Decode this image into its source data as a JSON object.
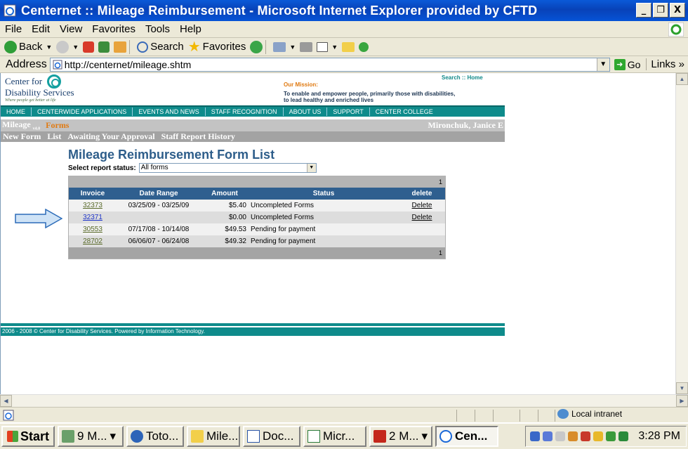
{
  "window": {
    "title": "Centernet :: Mileage Reimbursement - Microsoft Internet Explorer provided by CFTD",
    "minimize": "_",
    "maximize": "ř",
    "close": "X"
  },
  "menu": [
    "File",
    "Edit",
    "View",
    "Favorites",
    "Tools",
    "Help"
  ],
  "toolbar": {
    "back": "Back",
    "search": "Search",
    "favorites": "Favorites"
  },
  "address": {
    "label": "Address",
    "url": "http://centernet/mileage.shtm",
    "go": "Go",
    "links": "Links"
  },
  "site": {
    "logo_line1": "Center for",
    "logo_line2": "Disability Services",
    "logo_tagline": "Where people get better at life",
    "mission_label": "Our Mission:",
    "mission_text_1": "To enable and empower people, primarily those with disabilities,",
    "mission_text_2": "to lead healthy and enriched lives",
    "toplinks": "Search :: Home",
    "nav": [
      "HOME",
      "CENTERWIDE APPLICATIONS",
      "EVENTS AND NEWS",
      "STAFF RECOGNITION",
      "ABOUT US",
      "SUPPORT",
      "CENTER COLLEGE"
    ],
    "app_name": "Mileage",
    "app_version": "v4.0",
    "section": "Forms",
    "user": "Mironchuk, Janice E",
    "subnav": [
      "New Form",
      "List",
      "Awaiting Your Approval",
      "Staff Report History"
    ],
    "footer": "2006 - 2008 © Center for Disability Services. Powered by Information Technology."
  },
  "form": {
    "title": "Mileage Reimbursement Form List",
    "status_label": "Select report status:",
    "status_value": "All forms",
    "page_top": "1",
    "page_bottom": "1",
    "columns": [
      "Invoice",
      "Date Range",
      "Amount",
      "Status",
      "delete"
    ],
    "rows": [
      {
        "invoice": "32373",
        "range": "03/25/09 - 03/25/09",
        "amount": "$5.40",
        "status": "Uncompleted Forms",
        "delete": "Delete"
      },
      {
        "invoice": "32371",
        "range": "",
        "amount": "$0.00",
        "status": "Uncompleted Forms",
        "delete": "Delete"
      },
      {
        "invoice": "30553",
        "range": "07/17/08 - 10/14/08",
        "amount": "$49.53",
        "status": "Pending for payment",
        "delete": ""
      },
      {
        "invoice": "28702",
        "range": "06/06/07 - 06/24/08",
        "amount": "$49.32",
        "status": "Pending for payment",
        "delete": ""
      }
    ]
  },
  "statusbar": {
    "zone": "Local intranet"
  },
  "taskbar": {
    "start": "Start",
    "tasks": [
      "9 M...",
      "Toto...",
      "Mile...",
      "Doc...",
      "Micr...",
      "2 M...",
      "Cen..."
    ],
    "clock": "3:28 PM"
  },
  "colors": {
    "title_bar": "#0842b8",
    "site_nav": "#0e8b8b",
    "table_header": "#2f5f8f",
    "accent_orange": "#e07a12",
    "arrow_fill": "#cfe3f6"
  }
}
